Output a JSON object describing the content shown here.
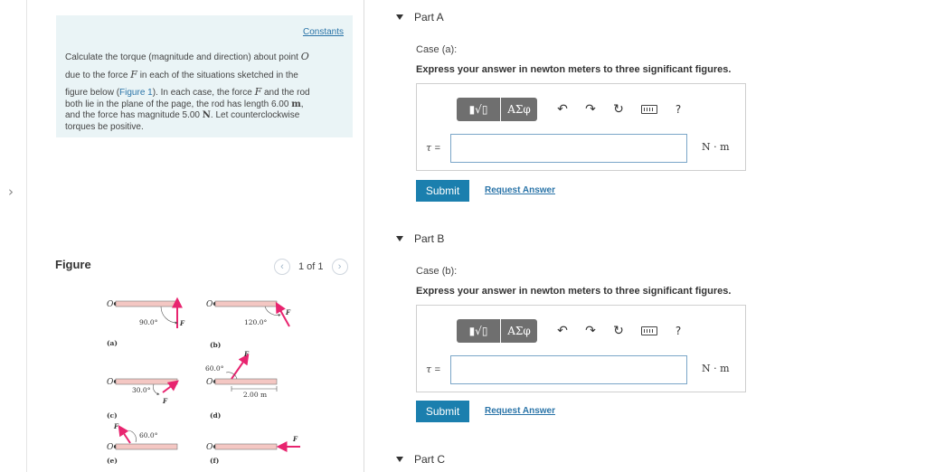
{
  "intro": {
    "constants_link": "Constants",
    "line1a": "Calculate the torque (magnitude and direction) about point ",
    "line1_point": "O",
    "line2a": "due to the force ",
    "force_symbol": "F",
    "line2b": " in each of the situations sketched in the",
    "line3a": "figure below (",
    "figure_link": "Figure 1",
    "line3b": "). In each case, the force ",
    "line3c": " and the rod",
    "line4a": "both lie in the plane of the page, the rod has length 6.00 ",
    "length_unit": "m",
    "line4b": ",",
    "line5a": "and the force has magnitude 5.00 ",
    "force_unit": "N",
    "line5b": ". Let counterclockwise",
    "line6": "torques be positive."
  },
  "figure": {
    "title": "Figure",
    "pager": "1 of 1",
    "prev_icon": "chevron-left-icon",
    "next_icon": "chevron-right-icon",
    "point_label": "O",
    "force_label": "F",
    "labels": {
      "a": "(a)",
      "b": "(b)",
      "c": "(c)",
      "d": "(d)",
      "e": "(e)",
      "f": "(f)"
    },
    "angles": {
      "a": "90.0°",
      "b": "120.0°",
      "c": "30.0°",
      "d": "60.0°",
      "e": "60.0°"
    },
    "distance_d": "2.00 m",
    "rod_color": "#f4c7c3",
    "force_color": "#e8246f"
  },
  "parts": [
    {
      "title": "Part A",
      "case_label": "Case (a):",
      "instruction": "Express your answer in newton meters to three significant figures.",
      "variable": "τ",
      "equals": "=",
      "units": "N · m",
      "submit": "Submit",
      "request": "Request Answer"
    },
    {
      "title": "Part B",
      "case_label": "Case (b):",
      "instruction": "Express your answer in newton meters to three significant figures.",
      "variable": "τ",
      "equals": "=",
      "units": "N · m",
      "submit": "Submit",
      "request": "Request Answer"
    },
    {
      "title": "Part C"
    }
  ],
  "toolbar": {
    "templates_label": "▮√▯",
    "greek_label": "ΑΣφ",
    "undo_icon": "undo-icon",
    "redo_icon": "redo-icon",
    "reset_icon": "reset-icon",
    "keyboard_icon": "keyboard-icon",
    "help_label": "?"
  },
  "accent_color": "#1b7fae"
}
